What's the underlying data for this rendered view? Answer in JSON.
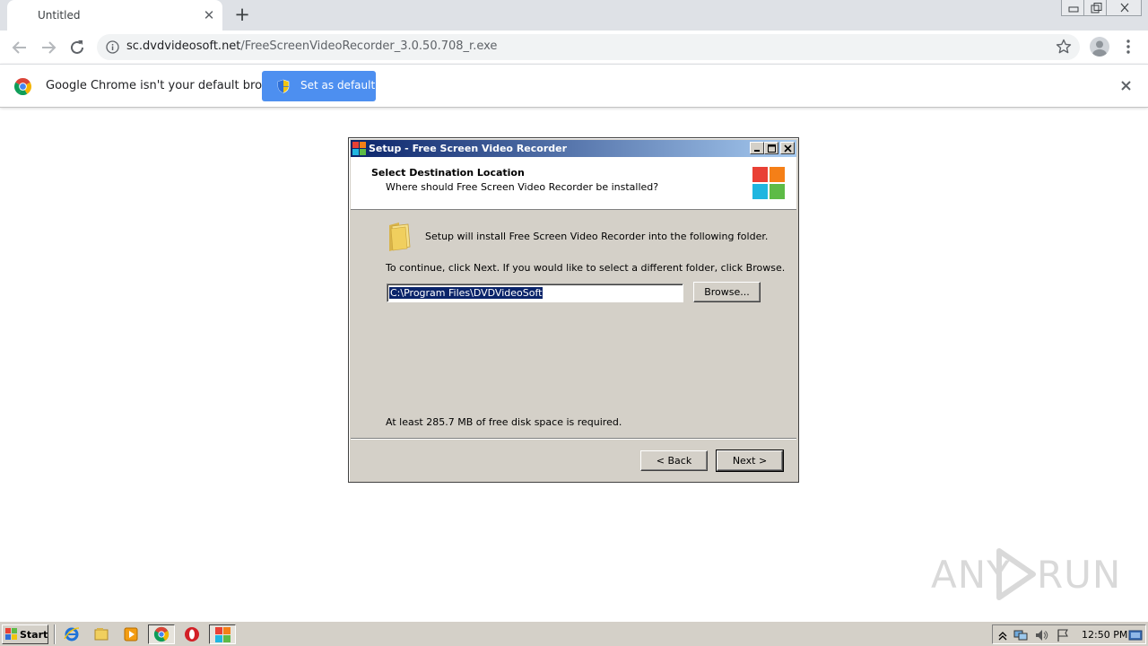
{
  "browser": {
    "tab": {
      "title": "Untitled"
    },
    "url": {
      "host": "sc.dvdvideosoft.net",
      "path": "/FreeScreenVideoRecorder_3.0.50.708_r.exe"
    }
  },
  "infobar": {
    "message": "Google Chrome isn't your default browser",
    "button_label": "Set as default"
  },
  "dialog": {
    "title": "Setup - Free Screen Video Recorder",
    "header_title": "Select Destination Location",
    "header_subtitle": "Where should Free Screen Video Recorder be installed?",
    "install_text": "Setup will install Free Screen Video Recorder into the following folder.",
    "continue_text": "To continue, click Next. If you would like to select a different folder, click Browse.",
    "path_value": "C:\\Program Files\\DVDVideoSoft",
    "browse_label": "Browse...",
    "disk_space_text": "At least 285.7 MB of free disk space is required.",
    "back_label": "< Back",
    "next_label": "Next >"
  },
  "watermark": {
    "left": "ANY",
    "right": "RUN"
  },
  "taskbar": {
    "start_label": "Start",
    "clock": "12:50 PM"
  },
  "colors": {
    "logo_red": "#e94035",
    "logo_orange": "#f57f17",
    "logo_cyan": "#1fb6e0",
    "logo_green": "#5dbb46",
    "chrome_blue": "#4d8ff0",
    "titlebar_start": "#0a246a",
    "titlebar_end": "#a6caf0"
  }
}
